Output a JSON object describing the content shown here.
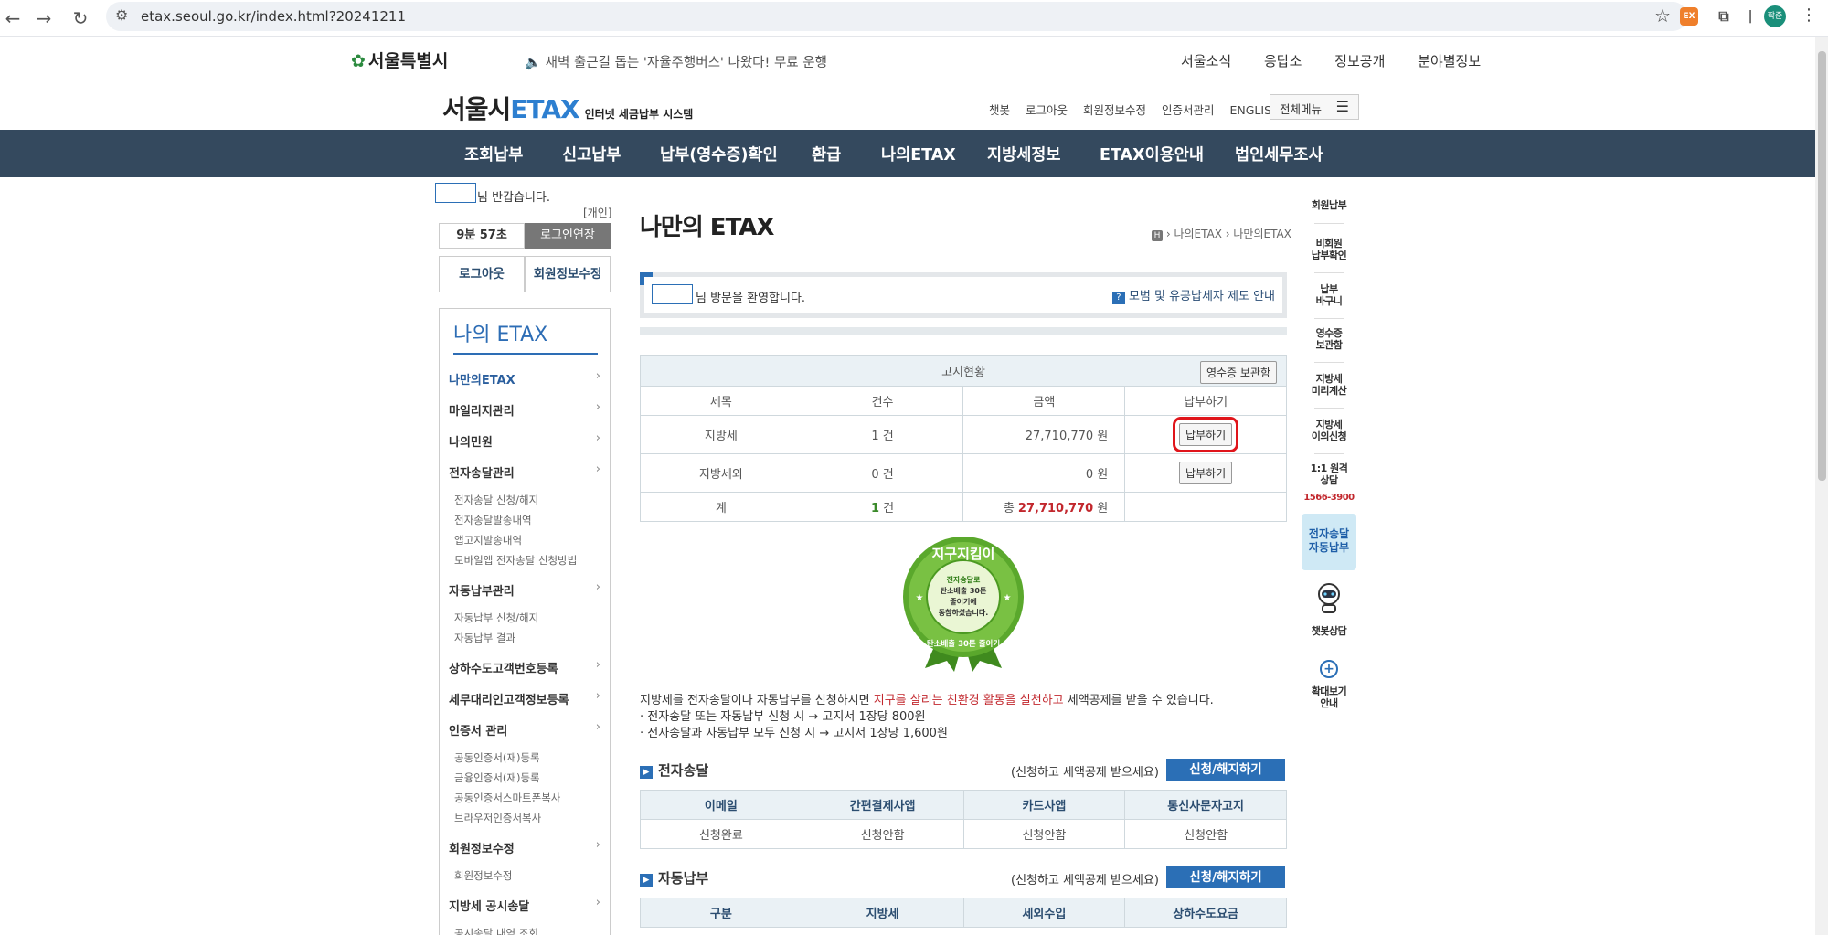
{
  "browser": {
    "url": "etax.seoul.go.kr/index.html?20241211",
    "profile_label": "학준"
  },
  "header": {
    "city_logo": "서울특별시",
    "notice": "새벽 출근길 돕는 '자율주행버스' 나왔다! 무료 운행",
    "top_links": [
      "서울소식",
      "응답소",
      "정보공개",
      "분야별정보"
    ],
    "brand_prefix": "서울시",
    "brand_main": "ETAX",
    "brand_sub": "인터넷 세금납부 시스템",
    "util_links": [
      "챗봇",
      "로그아웃",
      "회원정보수정",
      "인증서관리",
      "ENGLISH"
    ],
    "all_menu": "전체메뉴"
  },
  "mainnav": [
    "조회납부",
    "신고납부",
    "납부(영수증)확인",
    "환급",
    "나의ETAX",
    "지방세정보",
    "ETAX이용안내",
    "법인세무조사"
  ],
  "sidebar": {
    "greeting_suffix": "님 반갑습니다.",
    "account_type": "[개인]",
    "timer": "9분 57초",
    "extend_label": "로그인연장",
    "logout_label": "로그아웃",
    "member_label": "회원정보수정",
    "menu_title": "나의 ETAX",
    "items": [
      {
        "label": "나만의ETAX",
        "subs": []
      },
      {
        "label": "마일리지관리",
        "subs": []
      },
      {
        "label": "나의민원",
        "subs": []
      },
      {
        "label": "전자송달관리",
        "subs": [
          "전자송달 신청/해지",
          "전자송달발송내역",
          "앱고지발송내역",
          "모바일앱 전자송달 신청방법"
        ]
      },
      {
        "label": "자동납부관리",
        "subs": [
          "자동납부 신청/해지",
          "자동납부 결과"
        ]
      },
      {
        "label": "상하수도고객번호등록",
        "subs": []
      },
      {
        "label": "세무대리인고객정보등록",
        "subs": []
      },
      {
        "label": "인증서 관리",
        "subs": [
          "공동인증서(재)등록",
          "금융인증서(재)등록",
          "공동인증서스마트폰복사",
          "브라우저인증서복사"
        ]
      },
      {
        "label": "회원정보수정",
        "subs": [
          "회원정보수정"
        ]
      },
      {
        "label": "지방세 공시송달",
        "subs": [
          "공시송달 내역 조회"
        ]
      }
    ]
  },
  "content": {
    "title": "나만의 ETAX",
    "breadcrumb": [
      "나의ETAX",
      "나만의ETAX"
    ],
    "welcome_suffix": "님 방문을 환영합니다.",
    "faithful_link": "모범 및 유공납세자 제도 안내",
    "bill": {
      "caption": "고지현황",
      "receipt_btn": "영수증 보관함",
      "headers": [
        "세목",
        "건수",
        "금액",
        "납부하기"
      ],
      "rows": [
        {
          "type": "지방세",
          "count": "1 건",
          "amount": "27,710,770 원",
          "action": "납부하기"
        },
        {
          "type": "지방세외",
          "count": "0 건",
          "amount": "0 원",
          "action": "납부하기"
        }
      ],
      "total_label": "계",
      "total_count_num": "1",
      "total_count_unit": " 건",
      "total_amount_prefix": "총 ",
      "total_amount_num": "27,710,770",
      "total_amount_unit": " 원"
    },
    "badge": {
      "top": "지구지킴이",
      "line1": "전자송달로",
      "line2": "탄소배출 30톤",
      "line3": "줄이기에",
      "line4": "동참하셨습니다.",
      "bottom": "탄소배출 30톤 줄이기"
    },
    "promo": {
      "part1": "지방세를 전자송달이나 자동납부를 신청하시면 ",
      "highlight": "지구를 살리는 친환경 활동을 실천하고",
      "part2": " 세액공제를 받을 수 있습니다.",
      "line2": "· 전자송달 또는 자동납부 신청 시 → 고지서 1장당 800원",
      "line3": "· 전자송달과 자동납부 모두 신청 시 → 고지서 1장당 1,600원"
    },
    "esend": {
      "title": "전자송달",
      "hint": "(신청하고 세액공제 받으세요)",
      "button": "신청/해지하기",
      "headers": [
        "이메일",
        "간편결제사앱",
        "카드사앱",
        "통신사문자고지"
      ],
      "values": [
        "신청완료",
        "신청안함",
        "신청안함",
        "신청안함"
      ]
    },
    "autopay": {
      "title": "자동납부",
      "hint": "(신청하고 세액공제 받으세요)",
      "button": "신청/해지하기",
      "headers": [
        "구분",
        "지방세",
        "세외수입",
        "상하수도요금"
      ]
    }
  },
  "quickmenu": {
    "items": [
      "회원납부",
      "비회원\n납부확인",
      "납부\n바구니",
      "영수증\n보관함",
      "지방세\n미리계산",
      "지방세\n이의신청",
      "1:1 원격\n상담"
    ],
    "phone": "1566-3900",
    "ebox": "전자송달\n자동납부",
    "chatbot": "챗봇상담",
    "zoom": "확대보기\n안내"
  },
  "colors": {
    "nav_bg": "#34495e",
    "accent": "#2b6fb6",
    "highlight": "#e0151b"
  }
}
